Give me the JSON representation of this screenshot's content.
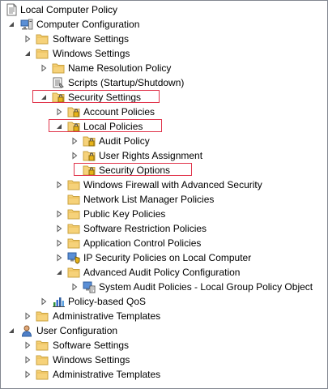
{
  "tree": {
    "nodes": [
      {
        "id": "n0",
        "label": "Local Computer Policy",
        "icon": "policy-doc-icon",
        "expander": "none",
        "level": 0
      },
      {
        "id": "n1",
        "label": "Computer Configuration",
        "icon": "computer-icon",
        "expander": "expanded",
        "level": 0
      },
      {
        "id": "n2",
        "label": "Software Settings",
        "icon": "folder-icon",
        "expander": "collapsed",
        "level": 1
      },
      {
        "id": "n3",
        "label": "Windows Settings",
        "icon": "folder-icon",
        "expander": "expanded",
        "level": 1
      },
      {
        "id": "n4",
        "label": "Name Resolution Policy",
        "icon": "folder-icon",
        "expander": "collapsed",
        "level": 2
      },
      {
        "id": "n5",
        "label": "Scripts (Startup/Shutdown)",
        "icon": "scripts-icon",
        "expander": "none",
        "level": 2
      },
      {
        "id": "n6",
        "label": "Security Settings",
        "icon": "security-folder-icon",
        "expander": "expanded",
        "level": 2,
        "highlighted": true
      },
      {
        "id": "n7",
        "label": "Account Policies",
        "icon": "security-folder-icon",
        "expander": "collapsed",
        "level": 3
      },
      {
        "id": "n8",
        "label": "Local Policies",
        "icon": "security-folder-icon",
        "expander": "expanded",
        "level": 3,
        "highlighted": true
      },
      {
        "id": "n9",
        "label": "Audit Policy",
        "icon": "security-folder-icon",
        "expander": "collapsed",
        "level": 4
      },
      {
        "id": "n10",
        "label": "User Rights Assignment",
        "icon": "security-folder-icon",
        "expander": "collapsed",
        "level": 4
      },
      {
        "id": "n11",
        "label": "Security Options",
        "icon": "security-folder-icon",
        "expander": "none",
        "level": 4,
        "highlighted": true
      },
      {
        "id": "n12",
        "label": "Windows Firewall with Advanced Security",
        "icon": "folder-icon",
        "expander": "collapsed",
        "level": 3
      },
      {
        "id": "n13",
        "label": "Network List Manager Policies",
        "icon": "folder-icon",
        "expander": "none",
        "level": 3
      },
      {
        "id": "n14",
        "label": "Public Key Policies",
        "icon": "folder-icon",
        "expander": "collapsed",
        "level": 3
      },
      {
        "id": "n15",
        "label": "Software Restriction Policies",
        "icon": "folder-icon",
        "expander": "collapsed",
        "level": 3
      },
      {
        "id": "n16",
        "label": "Application Control Policies",
        "icon": "folder-icon",
        "expander": "collapsed",
        "level": 3
      },
      {
        "id": "n17",
        "label": "IP Security Policies on Local Computer",
        "icon": "ipsec-icon",
        "expander": "collapsed",
        "level": 3
      },
      {
        "id": "n18",
        "label": "Advanced Audit Policy Configuration",
        "icon": "folder-icon",
        "expander": "expanded",
        "level": 3
      },
      {
        "id": "n19",
        "label": "System Audit Policies - Local Group Policy Object",
        "icon": "audit-policy-icon",
        "expander": "collapsed",
        "level": 4
      },
      {
        "id": "n20",
        "label": "Policy-based QoS",
        "icon": "qos-chart-icon",
        "expander": "collapsed",
        "level": 2
      },
      {
        "id": "n21",
        "label": "Administrative Templates",
        "icon": "folder-icon",
        "expander": "collapsed",
        "level": 1
      },
      {
        "id": "n22",
        "label": "User Configuration",
        "icon": "user-icon",
        "expander": "expanded",
        "level": 0
      },
      {
        "id": "n23",
        "label": "Software Settings",
        "icon": "folder-icon",
        "expander": "collapsed",
        "level": 1
      },
      {
        "id": "n24",
        "label": "Windows Settings",
        "icon": "folder-icon",
        "expander": "collapsed",
        "level": 1
      },
      {
        "id": "n25",
        "label": "Administrative Templates",
        "icon": "folder-icon",
        "expander": "collapsed",
        "level": 1
      }
    ]
  },
  "colors": {
    "highlight_border": "#e0334a",
    "folder_fill": "#f6d27a",
    "folder_stroke": "#c9a23f",
    "expander_stroke": "#555555",
    "tree_border": "#828790"
  }
}
